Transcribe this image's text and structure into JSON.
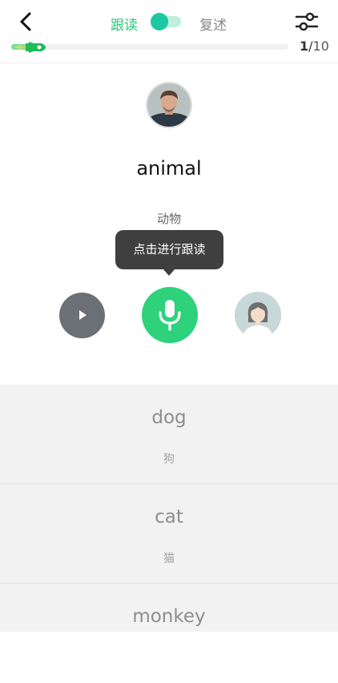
{
  "header": {
    "mode_follow": "跟读",
    "mode_retell": "复述",
    "progress": {
      "current": "1",
      "separator": "/",
      "total": "10",
      "fraction": 0.1
    }
  },
  "card": {
    "word": "animal",
    "meaning": "动物",
    "tooltip": "点击进行跟读"
  },
  "list": [
    {
      "word": "dog",
      "meaning": "狗"
    },
    {
      "word": "cat",
      "meaning": "猫"
    },
    {
      "word": "monkey",
      "meaning": ""
    }
  ],
  "colors": {
    "accent": "#2dd27b",
    "toggle": "#1bc8a2",
    "play_button": "#6b6f76",
    "tooltip_bg": "#3f3f3f"
  },
  "icons": [
    "back-icon",
    "settings-sliders-icon",
    "rocket-icon",
    "play-icon",
    "microphone-icon",
    "user-avatar-icon"
  ]
}
